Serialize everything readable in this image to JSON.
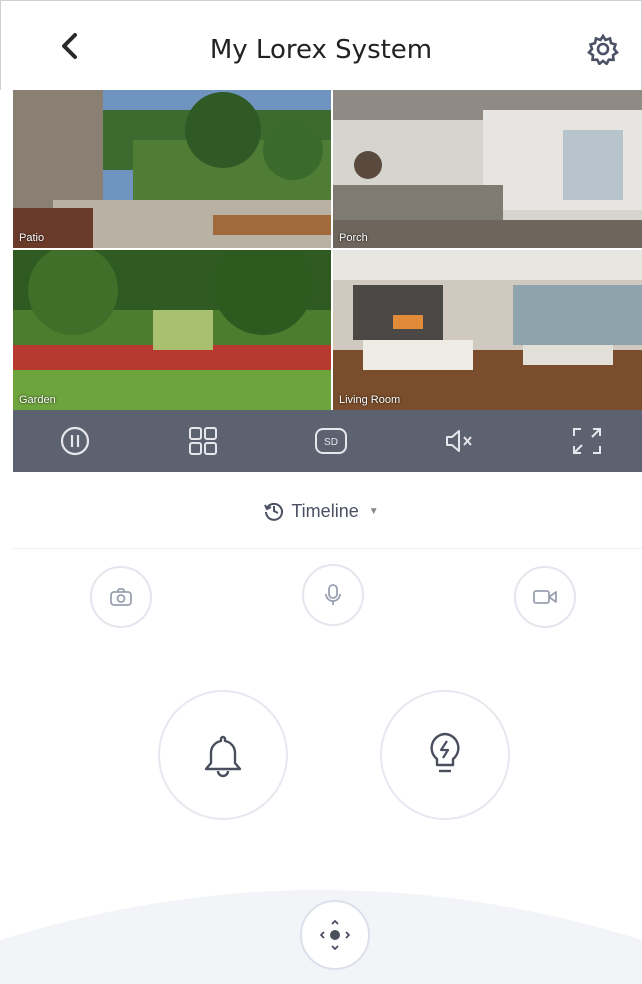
{
  "header": {
    "title": "My Lorex System",
    "back_icon": "chevron-left-icon",
    "settings_icon": "gear-icon"
  },
  "cameras": [
    {
      "label": "Patio"
    },
    {
      "label": "Porch"
    },
    {
      "label": "Garden"
    },
    {
      "label": "Living Room"
    }
  ],
  "controls": [
    {
      "name": "pause",
      "icon": "pause-icon"
    },
    {
      "name": "grid",
      "icon": "grid-layout-icon"
    },
    {
      "name": "quality",
      "icon": "sd-quality-icon",
      "text": "SD"
    },
    {
      "name": "mute",
      "icon": "speaker-muted-icon"
    },
    {
      "name": "fullscreen",
      "icon": "fullscreen-icon"
    }
  ],
  "timeline": {
    "label": "Timeline",
    "icon": "clock-history-icon"
  },
  "actions": [
    {
      "name": "snapshot",
      "icon": "camera-icon"
    },
    {
      "name": "talk",
      "icon": "microphone-icon"
    },
    {
      "name": "record",
      "icon": "video-camera-icon"
    }
  ],
  "big_actions": [
    {
      "name": "siren",
      "icon": "bell-icon"
    },
    {
      "name": "light",
      "icon": "lightbulb-icon"
    }
  ],
  "ptz": {
    "icon": "ptz-control-icon"
  },
  "colors": {
    "control_bar": "#5c6270",
    "icon_gray": "#9aa0b0",
    "accent_text": "#4a5062"
  }
}
